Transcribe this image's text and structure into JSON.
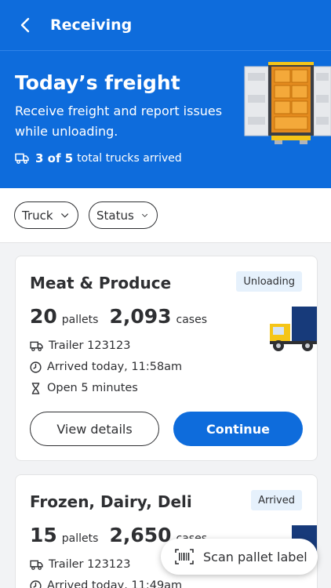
{
  "appbar": {
    "title": "Receiving"
  },
  "hero": {
    "title": "Today’s freight",
    "subtitle": "Receive freight and report issues while unloading.",
    "stat_bold": "3 of 5",
    "stat_text": "total trucks arrived"
  },
  "filters": [
    {
      "label": "Truck"
    },
    {
      "label": "Status"
    }
  ],
  "cards": [
    {
      "title": "Meat & Produce",
      "status": "Unloading",
      "pallets": "20",
      "pallets_unit": "pallets",
      "cases": "2,093",
      "cases_unit": "cases",
      "trailer": "Trailer 123123",
      "arrived": "Arrived today, 11:58am",
      "open": "Open 5 minutes",
      "details_label": "View details",
      "continue_label": "Continue"
    },
    {
      "title": "Frozen, Dairy, Deli",
      "status": "Arrived",
      "pallets": "15",
      "pallets_unit": "pallets",
      "cases": "2,650",
      "cases_unit": "cases",
      "trailer": "Trailer 123123",
      "arrived": "Arrived today, 11:49am"
    }
  ],
  "fab": {
    "label": "Scan pallet label"
  },
  "colors": {
    "primary": "#0e6cdc",
    "badge_bg": "#e6f1fc",
    "truck_yellow": "#f5c518",
    "truck_navy": "#173a7a"
  }
}
